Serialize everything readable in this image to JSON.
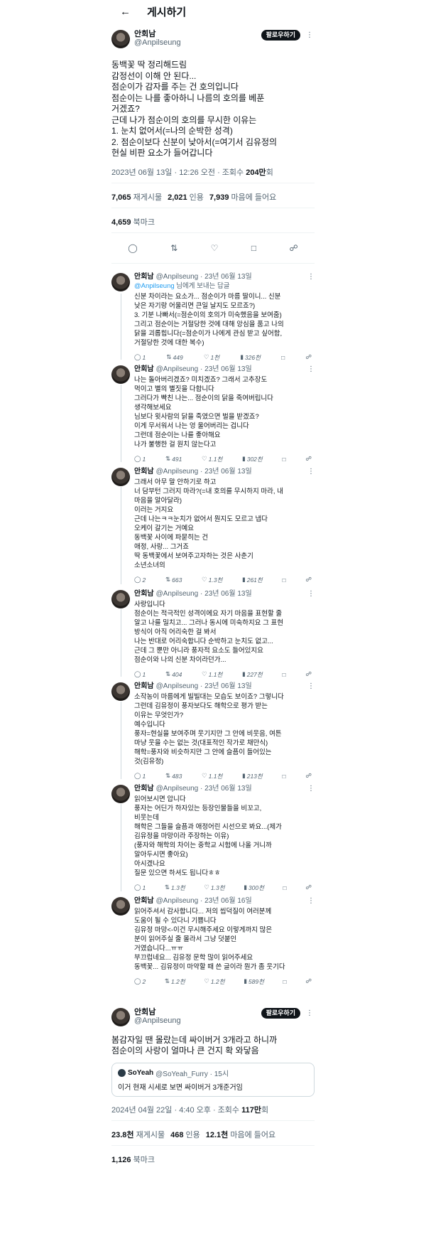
{
  "header": {
    "back_icon": "arrow-left-icon",
    "title": "게시하기"
  },
  "post1": {
    "name": "안회남",
    "handle": "@Anpilseung",
    "follow_label": "팔로우하기",
    "more_icon": "more-icon",
    "text": "동백꽃 딱 정리해드림\n감정선이 이해 안 된다...\n점순이가 감자를 주는 건 호의입니다\n점순이는 나를 좋아하니 나름의 호의를 베푼\n거겠죠?\n근데 나가 점순이의 호의를 무시한 이유는\n1. 눈치 없어서(=나의 순박한 성격)\n2. 점순이보다 신분이 낮아서(=여기서 김유정의\n현실 비판 요소가 들어갑니다",
    "time": "2023년 06월 13일 · 12:26 오전 · 조회수 ",
    "views": "204만",
    "views_suffix": "회",
    "stats": [
      {
        "value": "7,065",
        "label": "재게시물"
      },
      {
        "value": "2,021",
        "label": "인용"
      },
      {
        "value": "7,939",
        "label": "마음에 들어요"
      }
    ],
    "bookmarks": {
      "value": "4,659",
      "label": "북마크"
    },
    "actions": [
      "reply-icon",
      "repost-icon",
      "like-icon",
      "bookmark-icon",
      "share-icon"
    ]
  },
  "replies": [
    {
      "name": "안회남",
      "meta": "@Anpilseung · 23년 06월 13일",
      "to": "님에게 보내는 답글",
      "mention": "@Anpilseung",
      "text": "신분 차이라는 요소가... 점순이가 마름 딸이니... 신분\n낮은 자기랑 어울리면 큰일 날지도 모르죠?)\n3. 기분 나빠서(=점순이의 호의가 미숙했음을 보여줌)\n그리고 점순이는 거절당한 것에 대해 앙심을 품고 나의\n닭을 괴롭힙니다(=점순이가 나에게 관심 받고 싶어함,\n거절당한 것에 대한 복수)",
      "replies": "1",
      "reposts": "449",
      "likes": "1천",
      "views": "326천"
    },
    {
      "name": "안회남",
      "meta": "@Anpilseung · 23년 06월 13일",
      "to": "",
      "mention": "",
      "text": "나는 돌아버리겠죠? 미치겠죠? 그래서 고추장도\n먹이고 별의 별짓을 다합니다\n그러다가 빡친 나는... 점순이의 닭을 죽여버립니다\n생각해보세요\n님보다 윗사람의 닭을 죽였으면 벌을 받겠죠?\n이게 무서워서 나는 엉 울어버리는 겁니다\n그런데 점순이는 나를 좋아해요\n나가 불행한 걸 원치 않는다고",
      "replies": "1",
      "reposts": "491",
      "likes": "1.1천",
      "views": "302천"
    },
    {
      "name": "안회남",
      "meta": "@Anpilseung · 23년 06월 13일",
      "to": "",
      "mention": "",
      "text": "그래서 아무 말 안하기로 하고\n너 담부턴 그러지 마라?(=내 호의를 무시하지 마라, 내\n마음을 알아달라)\n이러는 거지요\n근데 나는ㅋㅋ눈치가 없어서 뭔지도 모르고 냅다\n오케이 갈기는 거예요\n동백꽃 사이에 파묻히는 건\n애정, 사랑... 그거죠\n딱 동백꽃에서 보여주고자하는 것은 사춘기\n소년소녀의",
      "replies": "2",
      "reposts": "663",
      "likes": "1.3천",
      "views": "261천"
    },
    {
      "name": "안회남",
      "meta": "@Anpilseung · 23년 06월 13일",
      "to": "",
      "mention": "",
      "text": "사랑입니다\n점순이는 적극적인 성격이에요 자기 마음을 표현할 줄\n알고 나를 밀치고... 그러나 동시에 미숙하지요 그 표현\n방식이 아직 어리숙한 걸 봐서\n나는 반대로 어리숙합니다 순박하고 눈치도 없고...\n근데 그 뿐만 아니라 풍자적 요소도 들어있지요\n점순이와 나의 신분 차이라던가...",
      "replies": "1",
      "reposts": "404",
      "likes": "1.1천",
      "views": "227천"
    },
    {
      "name": "안회남",
      "meta": "@Anpilseung · 23년 06월 13일",
      "to": "",
      "mention": "",
      "text": "소작농이 마름에게 빌빌대는 모습도 보이죠? 그렇니다\n그런데 김유정이 풍자보다도 해학으로 평가 받는\n이유는 무엇인가?\n예수입니다\n풍자=현실을 보여주며 웃기지만 그 안에 비웃음, 여튼\n마냥 웃을 수는 없는 것(대표적인 작가로 채만식)\n해학=풍자와 비슷하지만 그 안에 슬픔이 들어있는\n것(김유정)",
      "replies": "1",
      "reposts": "483",
      "likes": "1.1천",
      "views": "213천"
    },
    {
      "name": "안회남",
      "meta": "@Anpilseung · 23년 06월 13일",
      "to": "",
      "mention": "",
      "text": "읽어보시면 압니다\n풍자는 어딘가 하자있는 등장인물들을 비꼬고,\n비웃는데\n해학은 그들을 슬픔과 애정어린 시선으로 봐요...(제가\n김유정을 마망이라 주장하는 이유)\n(풍자와 해학의 차이는 중학교 시험에 나올 거니까\n알아두시면 좋아요)\n아시겠나요\n질문 있으면 하셔도 됩니다ㅎㅎ",
      "replies": "1",
      "reposts": "1.3천",
      "likes": "1.3천",
      "views": "300천"
    },
    {
      "name": "안회남",
      "meta": "@Anpilseung · 23년 06월 16일",
      "to": "",
      "mention": "",
      "text": "읽어주셔서 감사합니다... 저의 씹덕질이 여러분께\n도움이 될 수 있다니 기쁩니다\n김유정 마망<-이건 무시해주세요 이렇게까지 많은\n분이 읽어주실 줄 몰라서 그냥 덧붙인\n거였습니다...ㅠㅠ\n부끄럽네요... 김유정 문학 많이 읽어주세요\n동백꽃... 김유정이 마약할 때 쓴 글이라 뭔가 좀 웃기다",
      "replies": "2",
      "reposts": "1.2천",
      "likes": "1.2천",
      "views": "589천"
    }
  ],
  "post2": {
    "name": "안회남",
    "handle": "@Anpilseung",
    "follow_label": "팔로우하기",
    "text": "봄감자일 땐 몰랐는데 싸이버거 3개라고 하니까\n점순이의 사랑이 얼마나 큰 건지 확 와닿음",
    "quote": {
      "name": "SoYeah",
      "handle": "@SoYeah_Furry · 15시",
      "text": "이거 현재 시세로 보면 싸이버거 3개준거임"
    },
    "time": "2024년 04월 22일 · 4:40 오후 · 조회수 ",
    "views": "117만",
    "views_suffix": "회",
    "stats": [
      {
        "value": "23.8천",
        "label": "재게시물"
      },
      {
        "value": "468",
        "label": "인용"
      },
      {
        "value": "12.1천",
        "label": "마음에 들어요"
      }
    ],
    "bookmarks": {
      "value": "1,126",
      "label": "북마크"
    }
  }
}
